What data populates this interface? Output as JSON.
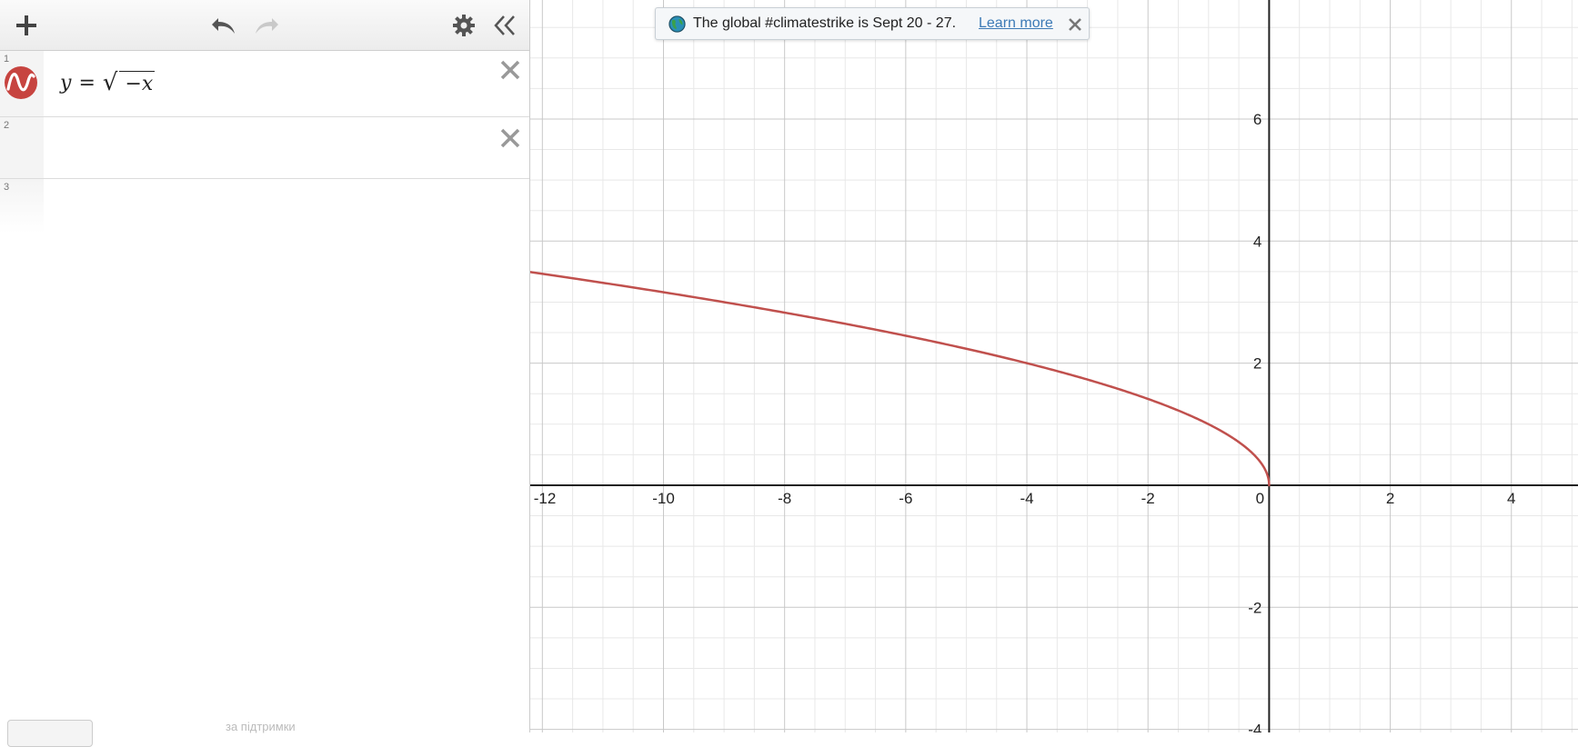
{
  "toolbar": {
    "add_icon": "plus-icon",
    "undo_icon": "undo-icon",
    "redo_icon": "redo-icon",
    "settings_icon": "gear-icon",
    "collapse_icon": "double-chevron-left-icon"
  },
  "expressions": [
    {
      "index": "1",
      "lhs": "y",
      "eq": "=",
      "radicand": "−x",
      "color": "#c74440"
    },
    {
      "index": "2"
    },
    {
      "index": "3"
    }
  ],
  "footer": {
    "text": "за підтримки"
  },
  "banner": {
    "text": "The global #climatestrike is Sept 20 - 27.",
    "link": "Learn more"
  },
  "graph": {
    "curve_color": "#c0504d",
    "grid_minor_color": "#e8e8e8",
    "grid_major_color": "#c8c8c8",
    "axis_color": "#222222"
  },
  "chart_data": {
    "type": "line",
    "function": "y = sqrt(-x)",
    "xlim": [
      -12.2,
      5.1
    ],
    "ylim": [
      -4.05,
      7.95
    ],
    "x_ticks": [
      -12,
      -10,
      -8,
      -6,
      -4,
      -2,
      0,
      2,
      4
    ],
    "y_ticks": [
      6,
      4,
      2,
      -2,
      -4
    ],
    "x_tick_labels": [
      "-12",
      "-10",
      "-8",
      "-6",
      "-4",
      "-2",
      "0",
      "2",
      "4"
    ],
    "y_tick_labels": [
      "6",
      "4",
      "2",
      "-2",
      "-4"
    ],
    "grid": true,
    "series": [
      {
        "x": [
          -12.2,
          -10,
          -8,
          -6,
          -4,
          -2,
          -1,
          -0.5,
          -0.1,
          0
        ],
        "y": [
          3.49,
          3.16,
          2.83,
          2.45,
          2.0,
          1.41,
          1.0,
          0.71,
          0.32,
          0
        ]
      }
    ]
  }
}
